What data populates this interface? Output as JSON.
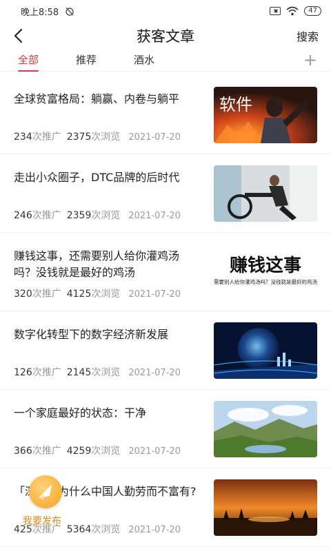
{
  "status_bar": {
    "time": "晚上8:58",
    "battery": "47"
  },
  "header": {
    "title": "获客文章",
    "search_label": "搜索"
  },
  "tabs": [
    {
      "label": "全部",
      "active": true
    },
    {
      "label": "推荐",
      "active": false
    },
    {
      "label": "酒水",
      "active": false
    }
  ],
  "tab_add_label": "+",
  "articles": [
    {
      "title": "全球贫富格局：躺赢、内卷与躺平",
      "promotions": "234",
      "promotions_unit": "次推广",
      "views": "2375",
      "views_unit": "次浏览",
      "date": "2021-07-20",
      "thumb_text": "软件"
    },
    {
      "title": "走出小众圈子，DTC品牌的后时代",
      "promotions": "246",
      "promotions_unit": "次推广",
      "views": "2359",
      "views_unit": "次浏览",
      "date": "2021-07-20"
    },
    {
      "title": "赚钱这事，还需要别人给你灌鸡汤吗？没钱就是最好的鸡汤",
      "promotions": "320",
      "promotions_unit": "次推广",
      "views": "4125",
      "views_unit": "次浏览",
      "date": "2021-07-20",
      "thumb_text": "赚钱这事",
      "thumb_subtext": "还需要别人给你灌鸡汤吗？没钱就是最好的鸡汤！"
    },
    {
      "title": "数字化转型下的数字经济新发展",
      "promotions": "126",
      "promotions_unit": "次推广",
      "views": "2145",
      "views_unit": "次浏览",
      "date": "2021-07-20"
    },
    {
      "title": "一个家庭最好的状态：干净",
      "promotions": "366",
      "promotions_unit": "次推广",
      "views": "4259",
      "views_unit": "次浏览",
      "date": "2021-07-20"
    },
    {
      "title": "「深度」为什么中国人勤劳而不富有?",
      "promotions": "425",
      "promotions_unit": "次推广",
      "views": "5364",
      "views_unit": "次浏览",
      "date": "2021-07-20"
    }
  ],
  "publish_button": {
    "label": "我要发布"
  },
  "colors": {
    "accent": "#d6383f",
    "fab": "#f6a21f"
  }
}
